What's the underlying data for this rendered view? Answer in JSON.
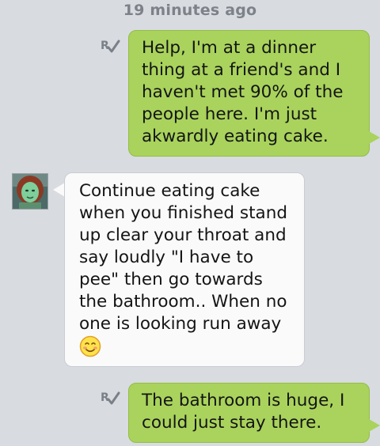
{
  "timestamp": "19 minutes ago",
  "messages": [
    {
      "direction": "outgoing",
      "lines": [
        "Help, I'm at a dinner",
        "thing at a friend's and I",
        "haven't met 90% of the",
        "people here. I'm just",
        "akwardly eating cake."
      ]
    },
    {
      "direction": "incoming",
      "lines": [
        "Continue eating cake",
        "when you finished stand",
        "up clear your throat and",
        "say loudly \"I have to",
        "pee\" then go towards",
        "the bathroom.. When no",
        "one is looking run away"
      ],
      "emoji": "smiling-face-icon"
    },
    {
      "direction": "outgoing",
      "lines": [
        "The bathroom is huge, I",
        "could just stay there."
      ]
    }
  ],
  "colors": {
    "background": "#d8dbe0",
    "outgoing_bubble": "#a9d35c",
    "incoming_bubble": "#fafafa",
    "timestamp": "#7d8188",
    "read_icon": "#7a8088"
  },
  "icons": {
    "read_receipt": "read-receipt-icon",
    "avatar": "contact-avatar"
  }
}
